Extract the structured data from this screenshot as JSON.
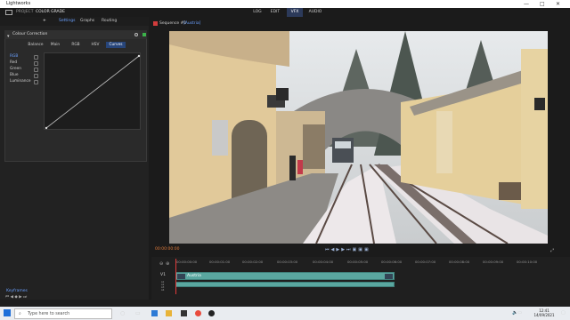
{
  "window": {
    "title": "Lightworks",
    "controls": [
      "—",
      "□",
      "✕"
    ]
  },
  "app": {
    "project_label": "PROJECT",
    "project_name": "COLOR GRADE",
    "nav": [
      {
        "label": "LOG",
        "active": false
      },
      {
        "label": "EDIT",
        "active": false
      },
      {
        "label": "VFX",
        "active": true
      },
      {
        "label": "AUDIO",
        "active": false
      }
    ]
  },
  "left_panel": {
    "add": "+",
    "tabs": [
      "Settings",
      "Graphs",
      "Routing"
    ],
    "effect_title": "Colour Correction",
    "cc_tabs": [
      {
        "label": "Balance",
        "selected": false
      },
      {
        "label": "Main",
        "selected": false
      },
      {
        "label": "RGB",
        "selected": false
      },
      {
        "label": "HSV",
        "selected": false
      },
      {
        "label": "Curves",
        "selected": true
      }
    ],
    "channels": [
      {
        "label": "RGB",
        "selected": true
      },
      {
        "label": "Red",
        "selected": false
      },
      {
        "label": "Green",
        "selected": false
      },
      {
        "label": "Blue",
        "selected": false
      },
      {
        "label": "Luminance",
        "selected": false
      }
    ],
    "keyframes_label": "Keyframes"
  },
  "viewer": {
    "sequence": "Sequence #1",
    "clip": "[Austria]",
    "timecode": "00:00:00:00"
  },
  "timeline": {
    "ruler": [
      "00:00:00:00",
      "00:00:01:00",
      "00:00:02:00",
      "00:00:03:00",
      "00:00:04:00",
      "00:00:05:00",
      "00:00:06:00",
      "00:00:07:00",
      "00:00:08:00",
      "00:00:09:00",
      "00:00:10:00"
    ],
    "track_v1": "V1",
    "audio_tracks": [
      "A1",
      "A2",
      "A3",
      "A4"
    ],
    "clip_name": "Austria"
  },
  "taskbar": {
    "search_placeholder": "Type here to search",
    "time": "12:41",
    "date": "14/09/2021"
  }
}
